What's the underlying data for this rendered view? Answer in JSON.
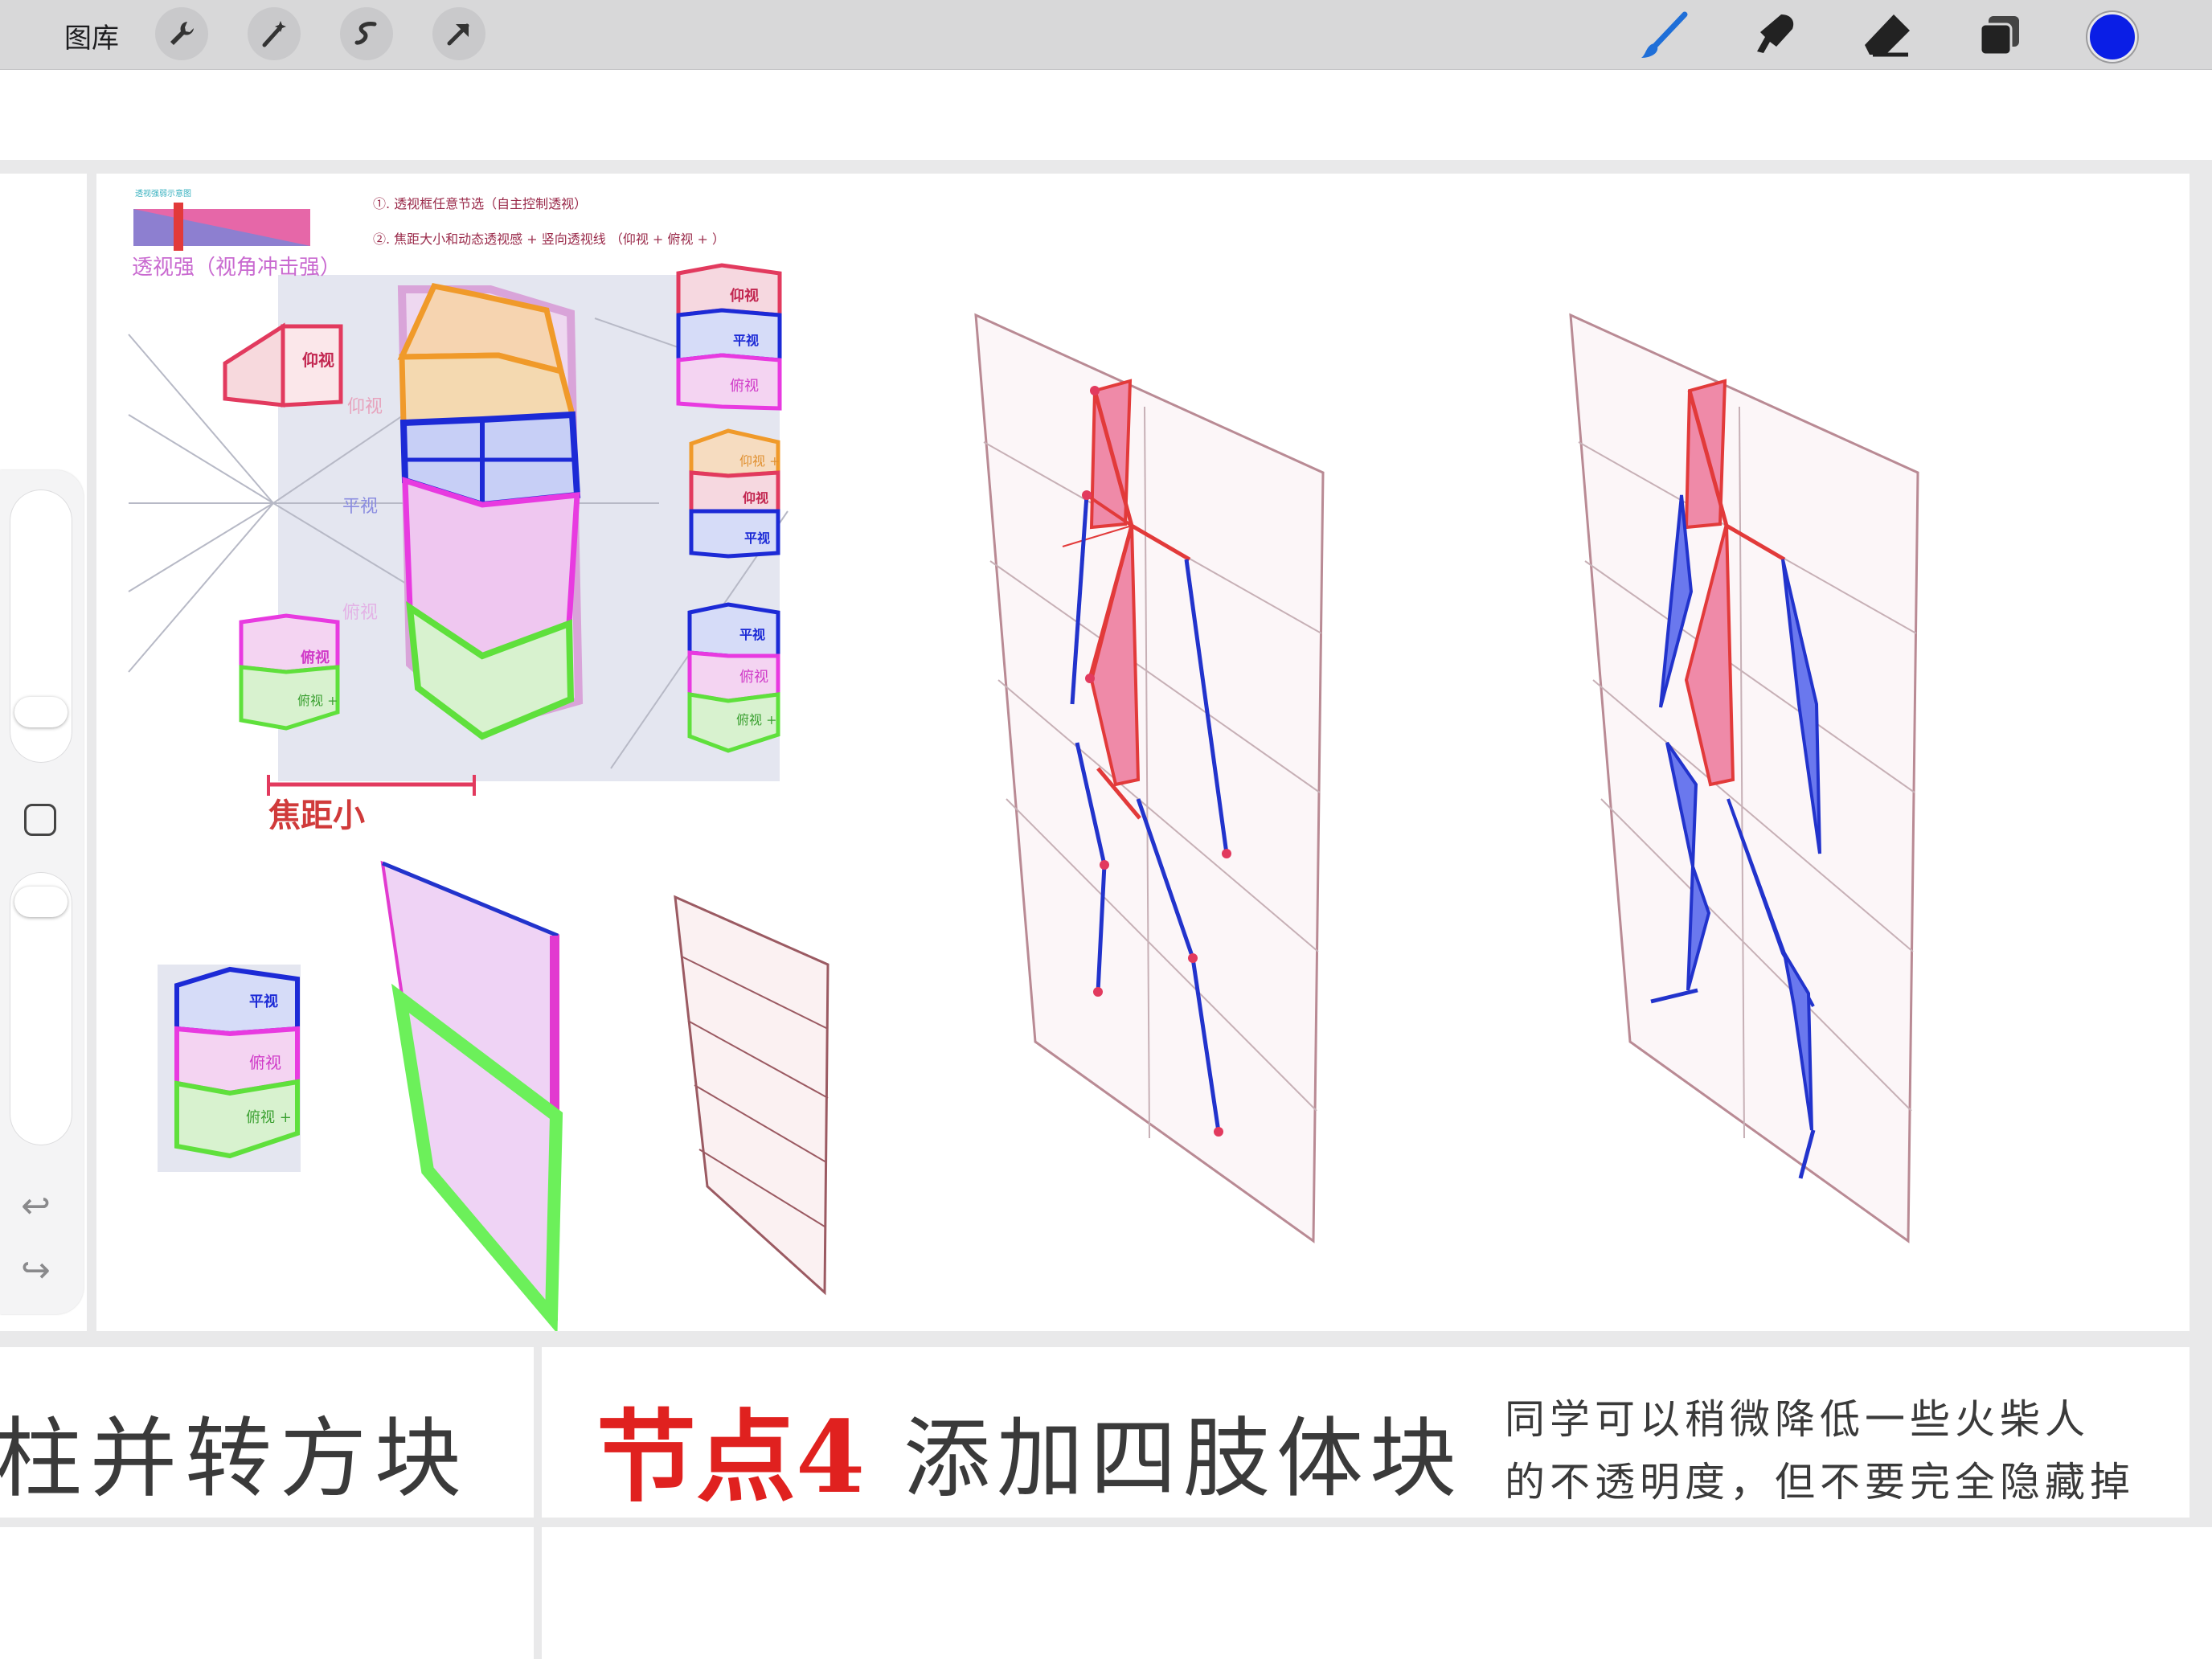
{
  "toolbar": {
    "gallery_label": "图库",
    "left_tools": [
      "wrench-icon",
      "magic-wand-icon",
      "selection-icon",
      "transform-arrow-icon"
    ],
    "right_tools": [
      "brush-icon",
      "smudge-icon",
      "eraser-icon",
      "layers-icon"
    ],
    "current_color": "#0a1ee6"
  },
  "canvas": {
    "reference": {
      "tiny_header": "透视强弱示意图",
      "note1": "①. 透视框任意节选（自主控制透视）",
      "note2": "②. 焦距大小和动态透视感 + 竖向透视线 （仰视 +  俯视 + ）",
      "strong_label": "透视强（视角冲击强）",
      "up_view": "仰视",
      "flat_view": "平视",
      "down_view": "俯视",
      "up_view_plus": "仰视 +",
      "down_view_plus": "俯视 +",
      "focal_small": "焦距小"
    }
  },
  "captions": {
    "left_title": "柱并转方块",
    "node_label": "节点4",
    "main_title": "添加四肢体块",
    "note_line1": "同学可以稍微降低一些火柴人",
    "note_line2": "的不透明度，但不要完全隐藏掉"
  },
  "colors": {
    "accent_red": "#e0211f",
    "figure_red": "#e23a3a",
    "limb_blue": "#2233cc",
    "pink_fill": "#f08aa8"
  }
}
